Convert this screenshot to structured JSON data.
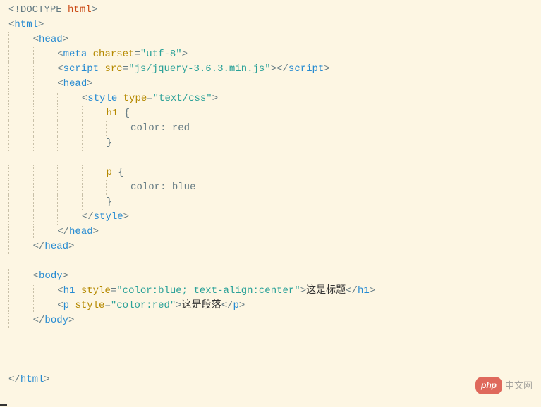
{
  "lines": [
    {
      "indent": 0,
      "tokens": [
        {
          "t": "<!",
          "c": "punct"
        },
        {
          "t": "DOCTYPE ",
          "c": "doctype"
        },
        {
          "t": "html",
          "c": "doctype-kw"
        },
        {
          "t": ">",
          "c": "punct"
        }
      ]
    },
    {
      "indent": 0,
      "tokens": [
        {
          "t": "<",
          "c": "punct"
        },
        {
          "t": "html",
          "c": "tag"
        },
        {
          "t": ">",
          "c": "punct"
        }
      ]
    },
    {
      "indent": 1,
      "tokens": [
        {
          "t": "<",
          "c": "punct"
        },
        {
          "t": "head",
          "c": "tag"
        },
        {
          "t": ">",
          "c": "punct"
        }
      ]
    },
    {
      "indent": 2,
      "tokens": [
        {
          "t": "<",
          "c": "punct"
        },
        {
          "t": "meta ",
          "c": "tag"
        },
        {
          "t": "charset",
          "c": "attr"
        },
        {
          "t": "=",
          "c": "punct"
        },
        {
          "t": "\"utf-8\"",
          "c": "str"
        },
        {
          "t": ">",
          "c": "punct"
        }
      ]
    },
    {
      "indent": 2,
      "tokens": [
        {
          "t": "<",
          "c": "punct"
        },
        {
          "t": "script ",
          "c": "tag"
        },
        {
          "t": "src",
          "c": "attr"
        },
        {
          "t": "=",
          "c": "punct"
        },
        {
          "t": "\"js/jquery-3.6.3.min.js\"",
          "c": "str"
        },
        {
          "t": "></",
          "c": "punct"
        },
        {
          "t": "script",
          "c": "tag"
        },
        {
          "t": ">",
          "c": "punct"
        }
      ]
    },
    {
      "indent": 2,
      "tokens": [
        {
          "t": "<",
          "c": "punct"
        },
        {
          "t": "head",
          "c": "tag"
        },
        {
          "t": ">",
          "c": "punct"
        }
      ]
    },
    {
      "indent": 3,
      "tokens": [
        {
          "t": "<",
          "c": "punct"
        },
        {
          "t": "style ",
          "c": "tag"
        },
        {
          "t": "type",
          "c": "attr"
        },
        {
          "t": "=",
          "c": "punct"
        },
        {
          "t": "\"text/css\"",
          "c": "str"
        },
        {
          "t": ">",
          "c": "punct"
        }
      ]
    },
    {
      "indent": 4,
      "tokens": [
        {
          "t": "h1 ",
          "c": "css-sel"
        },
        {
          "t": "{",
          "c": "punct"
        }
      ]
    },
    {
      "indent": 5,
      "tokens": [
        {
          "t": "color",
          "c": "css-prop"
        },
        {
          "t": ": red",
          "c": "css-val"
        }
      ]
    },
    {
      "indent": 4,
      "tokens": [
        {
          "t": "}",
          "c": "punct"
        }
      ]
    },
    {
      "indent": 0,
      "tokens": []
    },
    {
      "indent": 4,
      "tokens": [
        {
          "t": "p ",
          "c": "css-sel"
        },
        {
          "t": "{",
          "c": "punct"
        }
      ]
    },
    {
      "indent": 5,
      "tokens": [
        {
          "t": "color",
          "c": "css-prop"
        },
        {
          "t": ": blue",
          "c": "css-val"
        }
      ]
    },
    {
      "indent": 4,
      "tokens": [
        {
          "t": "}",
          "c": "punct"
        }
      ]
    },
    {
      "indent": 3,
      "tokens": [
        {
          "t": "</",
          "c": "punct"
        },
        {
          "t": "style",
          "c": "tag"
        },
        {
          "t": ">",
          "c": "punct"
        }
      ]
    },
    {
      "indent": 2,
      "tokens": [
        {
          "t": "</",
          "c": "punct"
        },
        {
          "t": "head",
          "c": "tag"
        },
        {
          "t": ">",
          "c": "punct"
        }
      ]
    },
    {
      "indent": 1,
      "tokens": [
        {
          "t": "</",
          "c": "punct"
        },
        {
          "t": "head",
          "c": "tag"
        },
        {
          "t": ">",
          "c": "punct"
        }
      ]
    },
    {
      "indent": 0,
      "tokens": []
    },
    {
      "indent": 1,
      "tokens": [
        {
          "t": "<",
          "c": "punct"
        },
        {
          "t": "body",
          "c": "tag"
        },
        {
          "t": ">",
          "c": "punct"
        }
      ]
    },
    {
      "indent": 2,
      "tokens": [
        {
          "t": "<",
          "c": "punct"
        },
        {
          "t": "h1 ",
          "c": "tag"
        },
        {
          "t": "style",
          "c": "attr"
        },
        {
          "t": "=",
          "c": "punct"
        },
        {
          "t": "\"color:blue; text-align:center\"",
          "c": "str"
        },
        {
          "t": ">",
          "c": "punct"
        },
        {
          "t": "这是标题",
          "c": "txt"
        },
        {
          "t": "</",
          "c": "punct"
        },
        {
          "t": "h1",
          "c": "tag"
        },
        {
          "t": ">",
          "c": "punct"
        }
      ]
    },
    {
      "indent": 2,
      "tokens": [
        {
          "t": "<",
          "c": "punct"
        },
        {
          "t": "p ",
          "c": "tag"
        },
        {
          "t": "style",
          "c": "attr"
        },
        {
          "t": "=",
          "c": "punct"
        },
        {
          "t": "\"color:red\"",
          "c": "str"
        },
        {
          "t": ">",
          "c": "punct"
        },
        {
          "t": "这是段落",
          "c": "txt"
        },
        {
          "t": "</",
          "c": "punct"
        },
        {
          "t": "p",
          "c": "tag"
        },
        {
          "t": ">",
          "c": "punct"
        }
      ]
    },
    {
      "indent": 1,
      "tokens": [
        {
          "t": "</",
          "c": "punct"
        },
        {
          "t": "body",
          "c": "tag"
        },
        {
          "t": ">",
          "c": "punct"
        }
      ]
    },
    {
      "indent": 0,
      "tokens": []
    },
    {
      "indent": 0,
      "tokens": []
    },
    {
      "indent": 0,
      "tokens": []
    },
    {
      "indent": 0,
      "tokens": [
        {
          "t": "</",
          "c": "punct"
        },
        {
          "t": "html",
          "c": "tag"
        },
        {
          "t": ">",
          "c": "punct"
        }
      ]
    }
  ],
  "watermark": {
    "brand": "php",
    "site": "中文网"
  },
  "indent_width": "    "
}
